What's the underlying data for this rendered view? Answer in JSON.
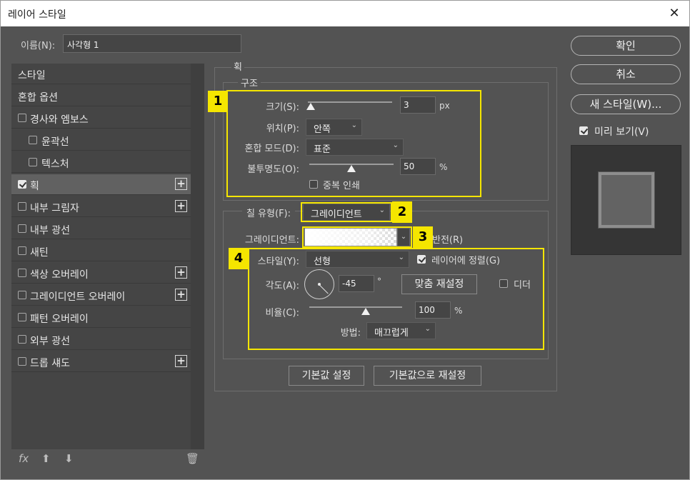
{
  "window": {
    "title": "레이어 스타일",
    "close_glyph": "✕"
  },
  "name": {
    "label": "이름(N):",
    "value": "사각형 1"
  },
  "styles": [
    {
      "label": "스타일",
      "check": "none",
      "plus": false,
      "selected": false
    },
    {
      "label": "혼합 옵션",
      "check": "none",
      "plus": false,
      "selected": false
    },
    {
      "label": "경사와 엠보스",
      "check": "off",
      "plus": false,
      "selected": false
    },
    {
      "label": "윤곽선",
      "check": "off",
      "plus": false,
      "selected": false,
      "sub": true
    },
    {
      "label": "텍스처",
      "check": "off",
      "plus": false,
      "selected": false,
      "sub": true
    },
    {
      "label": "획",
      "check": "on",
      "plus": true,
      "selected": true
    },
    {
      "label": "내부 그림자",
      "check": "off",
      "plus": true,
      "selected": false
    },
    {
      "label": "내부 광선",
      "check": "off",
      "plus": false,
      "selected": false
    },
    {
      "label": "새틴",
      "check": "off",
      "plus": false,
      "selected": false
    },
    {
      "label": "색상 오버레이",
      "check": "off",
      "plus": true,
      "selected": false
    },
    {
      "label": "그레이디언트 오버레이",
      "check": "off",
      "plus": true,
      "selected": false
    },
    {
      "label": "패턴 오버레이",
      "check": "off",
      "plus": false,
      "selected": false
    },
    {
      "label": "외부 광선",
      "check": "off",
      "plus": false,
      "selected": false
    },
    {
      "label": "드롭 섀도",
      "check": "off",
      "plus": true,
      "selected": false
    }
  ],
  "left_footer": {
    "fx": "fx",
    "up": "⬆",
    "down": "⬇",
    "trash": "🗑"
  },
  "stroke": {
    "title": "획",
    "structure": {
      "title": "구조",
      "size_label": "크기(S):",
      "size_value": "3",
      "size_unit": "px",
      "size_fraction": 0.03,
      "position_label": "위치(P):",
      "position_value": "안쪽",
      "blend_label": "혼합 모드(D):",
      "blend_value": "표준",
      "opacity_label": "불투명도(O):",
      "opacity_value": "50",
      "opacity_unit": "%",
      "opacity_fraction": 0.5,
      "overprint_label": "중복 인쇄"
    },
    "fill_type": {
      "label": "칠 유형(F):",
      "value": "그레이디언트"
    },
    "gradient": {
      "label": "그레이디언트:",
      "reverse_label": "반전(R)",
      "style_label": "스타일(Y):",
      "style_value": "선형",
      "align_label": "레이어에 정렬(G)",
      "angle_label": "각도(A):",
      "angle_value": "-45",
      "angle_unit": "°",
      "reset_align_label": "맞춤 재설정",
      "dither_label": "디더",
      "scale_label": "비율(C):",
      "scale_value": "100",
      "scale_unit": "%",
      "scale_fraction": 0.5,
      "method_label": "방법:",
      "method_value": "매끄럽게"
    },
    "default_button": "기본값 설정",
    "reset_button": "기본값으로 재설정"
  },
  "annotations": {
    "b1": "1",
    "b2": "2",
    "b3": "3",
    "b4": "4"
  },
  "right": {
    "ok": "확인",
    "cancel": "취소",
    "new_style": "새 스타일(W)...",
    "preview_label": "미리 보기(V)"
  },
  "colors": {
    "highlight": "#f5e600",
    "panel": "#535353",
    "field": "#454545"
  }
}
